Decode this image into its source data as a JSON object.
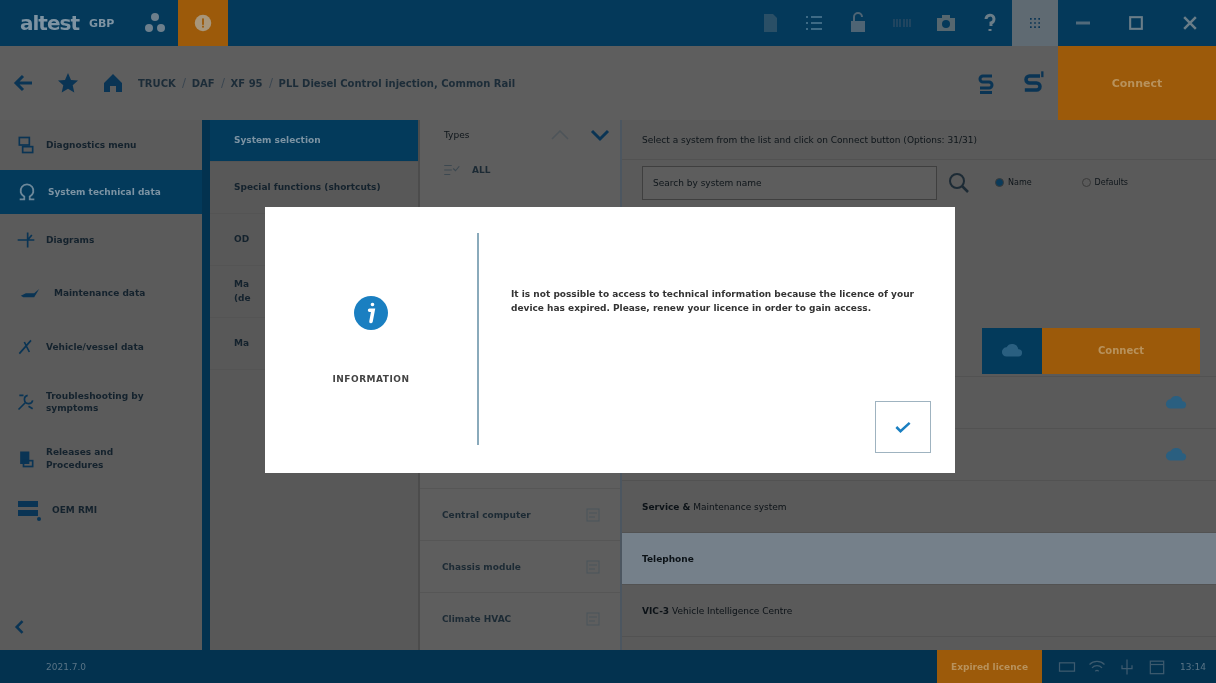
{
  "topbar": {
    "logo": "altest",
    "mode": "GBP",
    "alert_active": true,
    "grid_active": true
  },
  "breadcrumb": [
    "TRUCK",
    "DAF",
    "XF 95",
    "PLL Diesel Control injection, Common Rail"
  ],
  "connect_button": "Connect",
  "sidebar": {
    "items": [
      {
        "label": "Diagnostics menu",
        "selected": false
      },
      {
        "label": "System technical data",
        "selected": true
      },
      {
        "label": "Diagrams",
        "selected": false
      },
      {
        "label": "Maintenance data",
        "selected": false
      },
      {
        "label": "Vehicle/vessel data",
        "selected": false
      },
      {
        "label": "Troubleshooting by symptoms",
        "selected": false
      },
      {
        "label": "Releases and Procedures",
        "selected": false
      },
      {
        "label": "OEM RMI",
        "selected": false
      }
    ]
  },
  "submenu": {
    "items": [
      {
        "label": "System selection",
        "selected": true
      },
      {
        "label": "Special functions (shortcuts)",
        "selected": false
      },
      {
        "label": "OD",
        "selected": false
      },
      {
        "label": "Ma\n(de",
        "selected": false
      },
      {
        "label": "Ma",
        "selected": false
      }
    ]
  },
  "types": {
    "title": "Types",
    "top_item": "ALL",
    "items": [
      {
        "label": "Central computer",
        "checked": false
      },
      {
        "label": "Chassis module",
        "checked": false
      },
      {
        "label": "Climate HVAC",
        "checked": false
      }
    ]
  },
  "systems": {
    "instruction": "Select a system from the list and click on Connect button (Options: 31/31)",
    "search": {
      "placeholder": "Search by system name"
    },
    "radios": [
      {
        "label": "Name",
        "selected": true
      },
      {
        "label": "Defaults",
        "selected": false
      }
    ],
    "partial_rows": [
      {
        "kind": "connect",
        "label": "Connect"
      },
      {
        "kind": "cloud"
      },
      {
        "kind": "cloud"
      }
    ],
    "rows": [
      {
        "name": "**Service &** Maintenance system",
        "selected": false
      },
      {
        "name": "**Telephone**",
        "selected": true
      },
      {
        "name": "**VIC-3** Vehicle Intelligence Centre",
        "selected": false
      }
    ]
  },
  "status_bar": {
    "version": "2021.7.0",
    "licence": "Expired licence",
    "time": "13:14"
  },
  "dialog": {
    "title": "INFORMATION",
    "message": "It is not possible to access to technical information because the licence of your device has expired. Please, renew your licence in order to gain access."
  }
}
